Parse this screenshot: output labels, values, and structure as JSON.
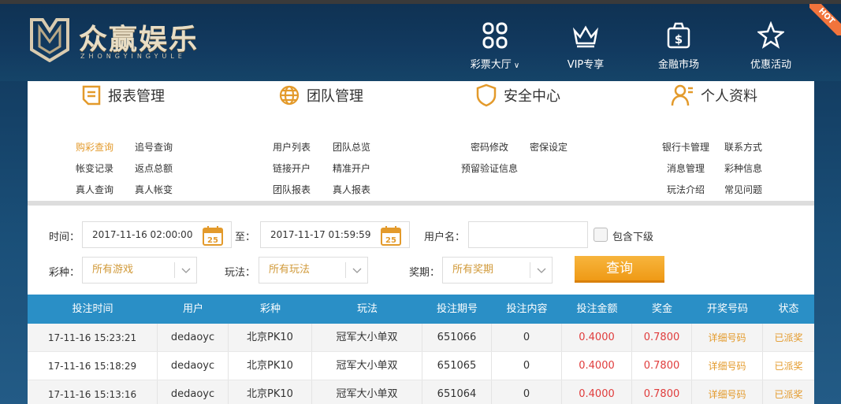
{
  "brand": {
    "title": "众赢娱乐",
    "subtitle": "ZHONGYINGYULE"
  },
  "topnav": [
    {
      "label": "彩票大厅",
      "icon": "lottery-grid-icon",
      "has_dropdown": true
    },
    {
      "label": "VIP专享",
      "icon": "crown-icon"
    },
    {
      "label": "金融市场",
      "icon": "money-bag-icon"
    },
    {
      "label": "优惠活动",
      "icon": "star-icon"
    }
  ],
  "hot_badge": "HOT",
  "menu": [
    {
      "title": "报表管理",
      "icon": "report-icon",
      "links": [
        "购彩查询",
        "追号查询",
        "帐变记录",
        "返点总额",
        "真人查询",
        "真人帐变"
      ],
      "active": "购彩查询"
    },
    {
      "title": "团队管理",
      "icon": "globe-icon",
      "links": [
        "用户列表",
        "团队总览",
        "链接开户",
        "精准开户",
        "团队报表",
        "真人报表"
      ]
    },
    {
      "title": "安全中心",
      "icon": "shield-icon",
      "links": [
        "密码修改",
        "密保设定",
        "预留验证信息"
      ]
    },
    {
      "title": "个人资料",
      "icon": "user-icon",
      "links": [
        "银行卡管理",
        "联系方式",
        "消息管理",
        "彩种信息",
        "玩法介绍",
        "常见问题"
      ]
    }
  ],
  "filters": {
    "time_label": "时间：",
    "start_time": "2017-11-16 02:00:00",
    "to_label": "至：",
    "end_time": "2017-11-17 01:59:59",
    "calendar_day": "25",
    "username_label": "用户名：",
    "username_value": "",
    "include_sub_label": "包含下级",
    "game_label": "彩种：",
    "game_value": "所有游戏",
    "play_label": "玩法：",
    "play_value": "所有玩法",
    "period_label": "奖期：",
    "period_value": "所有奖期",
    "query_button": "查询"
  },
  "table": {
    "headers": [
      "投注时间",
      "用户",
      "彩种",
      "玩法",
      "投注期号",
      "投注内容",
      "投注金额",
      "奖金",
      "开奖号码",
      "状态"
    ],
    "rows": [
      [
        "17-11-16 15:23:21",
        "dedaoyc",
        "北京PK10",
        "冠军大小单双",
        "651066",
        "0",
        "0.4000",
        "0.7800",
        "详细号码",
        "已派奖"
      ],
      [
        "17-11-16 15:18:29",
        "dedaoyc",
        "北京PK10",
        "冠军大小单双",
        "651065",
        "0",
        "0.4000",
        "0.7800",
        "详细号码",
        "已派奖"
      ],
      [
        "17-11-16 15:13:16",
        "dedaoyc",
        "北京PK10",
        "冠军大小单双",
        "651064",
        "0",
        "0.4000",
        "0.7800",
        "详细号码",
        "已派奖"
      ]
    ]
  },
  "colors": {
    "accent": "#e39a2b",
    "table_header": "#2a8fc6",
    "amount": "#e03c3c"
  }
}
